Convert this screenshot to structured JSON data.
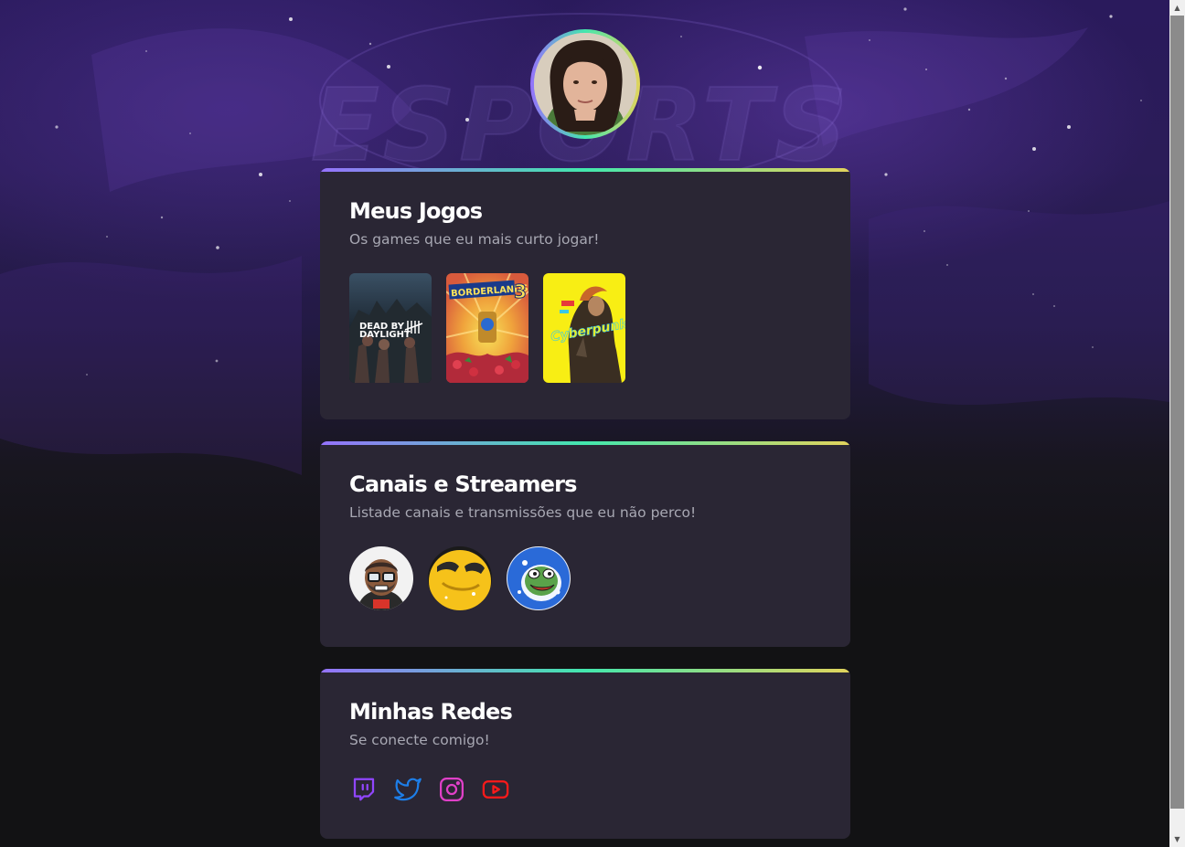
{
  "colors": {
    "card_bg": "#2a2634",
    "gradient": [
      "#9572fc",
      "#43e7ad",
      "#e2d45c"
    ],
    "twitch": "#9146ff",
    "twitter": "#1d7ee8",
    "instagram": "#e040c8",
    "youtube": "#ff1a1a"
  },
  "profile": {
    "icon": "profile-photo"
  },
  "games_card": {
    "title": "Meus Jogos",
    "subtitle": "Os games que eu mais curto jogar!",
    "games": [
      {
        "name": "DEAD BY DAYLIGHT",
        "line1": "DEAD BY",
        "line2": "DAYLIGHT"
      },
      {
        "name": "BORDERLANDS 3",
        "logo": "BORDERLANDS",
        "num": "3"
      },
      {
        "name": "CYBERPUNK",
        "logo": "Cyberpunk"
      }
    ]
  },
  "streams_card": {
    "title": "Canais e Streamers",
    "subtitle": "Listade canais e transmissões que eu não perco!",
    "streamers": [
      "streamer-avatar-1",
      "streamer-avatar-2",
      "streamer-avatar-3"
    ]
  },
  "social_card": {
    "title": "Minhas Redes",
    "subtitle": "Se conecte comigo!",
    "icons": [
      "twitch-icon",
      "twitter-icon",
      "instagram-icon",
      "youtube-icon"
    ]
  },
  "background": {
    "watermark": "ESPORTS"
  }
}
